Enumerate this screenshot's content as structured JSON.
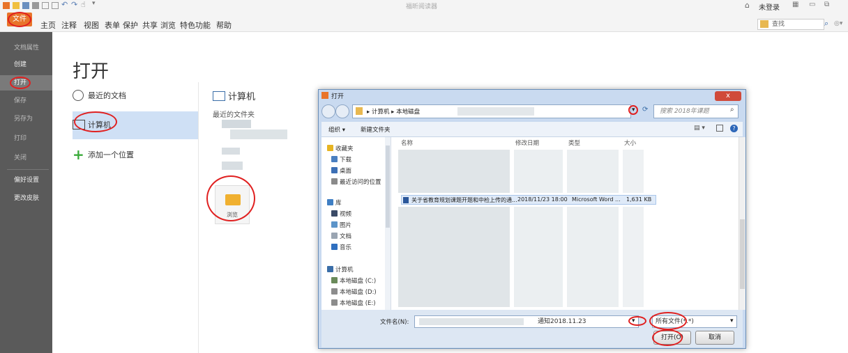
{
  "app": {
    "title": "福昕阅读器",
    "account": "未登录",
    "search_placeholder": "查找",
    "file_tab": "文件",
    "menu": [
      "主页",
      "注释",
      "视图",
      "表单",
      "保护",
      "共享",
      "浏览",
      "特色功能",
      "帮助"
    ]
  },
  "sidebar": {
    "items": [
      "文档属性",
      "创建",
      "打开",
      "保存",
      "另存为",
      "打印",
      "关闭",
      "偏好设置",
      "更改皮肤"
    ]
  },
  "open_page": {
    "title": "打开",
    "places": [
      "最近的文档",
      "计算机",
      "添加一个位置"
    ],
    "computer_heading": "计算机",
    "recent_folders": "最近的文件夹",
    "browse": "浏览"
  },
  "dialog": {
    "title": "打开",
    "close": "x",
    "breadcrumb": [
      "计算机",
      "本地磁盘"
    ],
    "search_placeholder": "搜索 2018年课题",
    "toolbar": {
      "organize": "组织 ▾",
      "new_folder": "新建文件夹"
    },
    "nav": [
      {
        "label": "收藏夹",
        "icon": "star-icon",
        "color": "#e6b422"
      },
      {
        "label": "下载",
        "icon": "download-icon",
        "color": "#4a7fc0"
      },
      {
        "label": "桌面",
        "icon": "desktop-icon",
        "color": "#3c6fb5"
      },
      {
        "label": "最近访问的位置",
        "icon": "recent-icon",
        "color": "#8a8a8a"
      },
      {
        "label": "库",
        "icon": "library-icon",
        "color": "#3f7fc4"
      },
      {
        "label": "视频",
        "icon": "video-icon",
        "color": "#3a4a66"
      },
      {
        "label": "图片",
        "icon": "picture-icon",
        "color": "#5c94c9"
      },
      {
        "label": "文档",
        "icon": "document-icon",
        "color": "#9aa5b2"
      },
      {
        "label": "音乐",
        "icon": "music-icon",
        "color": "#2f6fbf"
      },
      {
        "label": "计算机",
        "icon": "computer-icon",
        "color": "#3a6ea8"
      },
      {
        "label": "本地磁盘 (C:)",
        "icon": "drive-icon",
        "color": "#6a8a5a"
      },
      {
        "label": "本地磁盘 (D:)",
        "icon": "drive-icon",
        "color": "#8c8c8c"
      },
      {
        "label": "本地磁盘 (E:)",
        "icon": "drive-icon",
        "color": "#8c8c8c"
      }
    ],
    "columns": [
      "名称",
      "修改日期",
      "类型",
      "大小"
    ],
    "selected_file": {
      "name": "关于省教育规划课题开题和中检上传的通...",
      "date": "2018/11/23 18:00",
      "type": "Microsoft Word ...",
      "size": "1,631 KB"
    },
    "filename_label": "文件名(N):",
    "filename_value": "通知2018.11.23",
    "filter": "所有文件(*.*)",
    "open_button": "打开(O)",
    "cancel_button": "取消"
  }
}
